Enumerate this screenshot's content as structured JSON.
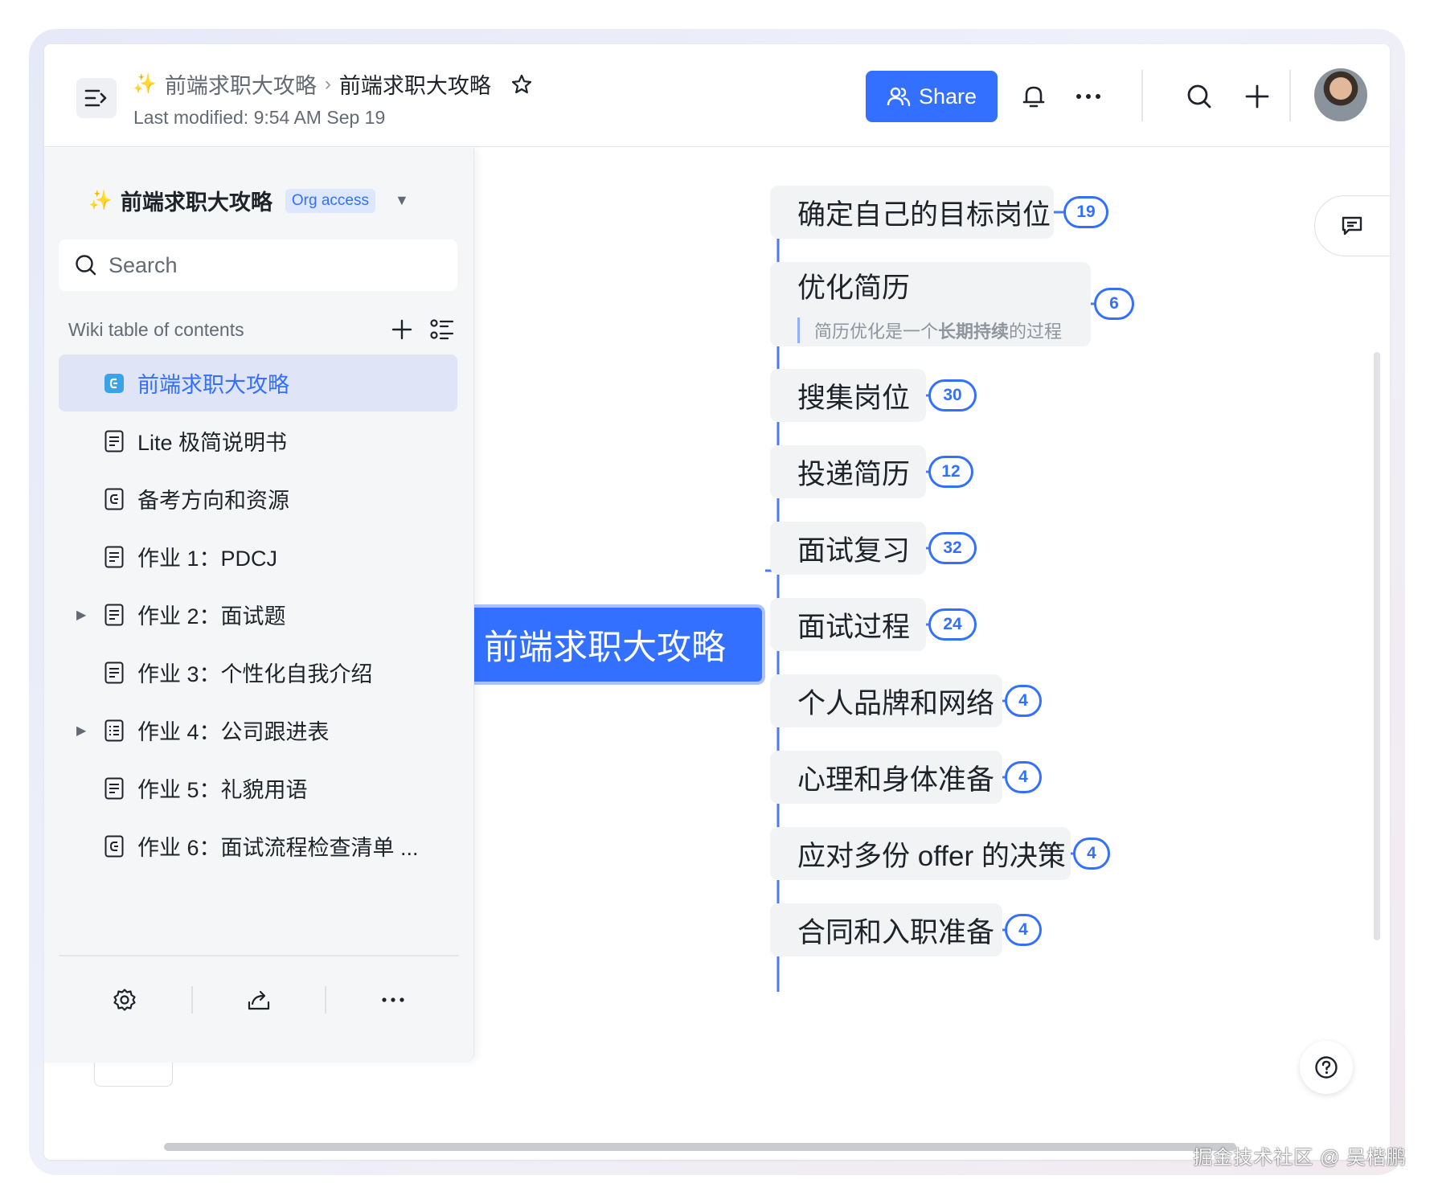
{
  "header": {
    "breadcrumb_root": "前端求职大攻略",
    "breadcrumb_current": "前端求职大攻略",
    "last_modified": "Last modified: 9:54 AM Sep 19",
    "share_label": "Share"
  },
  "sidebar": {
    "space_title": "前端求职大攻略",
    "org_badge": "Org access",
    "search_placeholder": "Search",
    "toc_title": "Wiki table of contents",
    "items": [
      {
        "label": "前端求职大攻略",
        "icon": "mindnote-icon",
        "active": true
      },
      {
        "label": "Lite 极简说明书",
        "icon": "doc-icon"
      },
      {
        "label": "备考方向和资源",
        "icon": "mindnote-icon"
      },
      {
        "label": "作业 1：PDCJ",
        "icon": "doc-icon"
      },
      {
        "label": "作业 2：面试题",
        "icon": "doc-icon",
        "expandable": true
      },
      {
        "label": "作业 3：个性化自我介绍",
        "icon": "doc-icon"
      },
      {
        "label": "作业 4：公司跟进表",
        "icon": "sheet-icon",
        "expandable": true
      },
      {
        "label": "作业 5：礼貌用语",
        "icon": "doc-icon"
      },
      {
        "label": "作业 6：面试流程检查清单 ...",
        "icon": "mindnote-icon"
      }
    ]
  },
  "mindmap": {
    "root": "前端求职大攻略",
    "children": [
      {
        "label": "确定自己的目标岗位",
        "count": "19"
      },
      {
        "label": "优化简历",
        "note_plain": "简历优化是一个",
        "note_bold": "长期持续",
        "note_tail": "的过程",
        "count": "6"
      },
      {
        "label": "搜集岗位",
        "count": "30"
      },
      {
        "label": "投递简历",
        "count": "12"
      },
      {
        "label": "面试复习",
        "count": "32"
      },
      {
        "label": "面试过程",
        "count": "24"
      },
      {
        "label": "个人品牌和网络",
        "count": "4"
      },
      {
        "label": "心理和身体准备",
        "count": "4"
      },
      {
        "label": "应对多份 offer 的决策",
        "count": "4"
      },
      {
        "label": "合同和入职准备",
        "count": "4"
      }
    ]
  },
  "watermark": "掘金技术社区 @ 吴楷鹏",
  "colors": {
    "accent": "#3370ff",
    "node_bg": "#f2f3f5",
    "active_bg": "#dfe4f7"
  }
}
